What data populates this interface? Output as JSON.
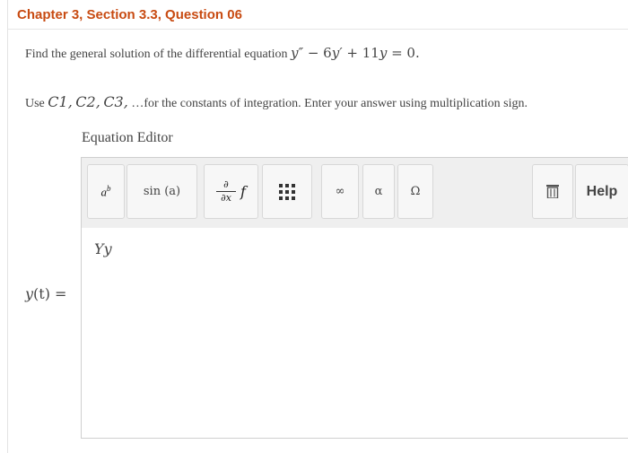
{
  "header": {
    "title": "Chapter 3, Section 3.3, Question 06"
  },
  "question": {
    "prefix": "Find the general solution of the differential equation",
    "equation_y": "y″",
    "equation_minus": " − 6",
    "equation_yp": "y′",
    "equation_plus": " + 11",
    "equation_y2": "y",
    "equation_eq": " = 0."
  },
  "instructions": {
    "use": "Use",
    "c1": "C1,",
    "c2": "C2,",
    "c3": "C3,",
    "rest": "…for the constants of integration. Enter your answer using multiplication sign."
  },
  "editor": {
    "label": "Equation Editor",
    "toolbar": {
      "power_base": "a",
      "power_exp": "b",
      "sin_label": "sin (a)",
      "partial_num": "∂",
      "partial_den": "∂x",
      "partial_f": "f",
      "infinity": "∞",
      "alpha": "α",
      "omega": "Ω",
      "help": "Help"
    },
    "answer_value": "Yy"
  },
  "answer_label": {
    "func": "y",
    "rest": "(t) ="
  }
}
